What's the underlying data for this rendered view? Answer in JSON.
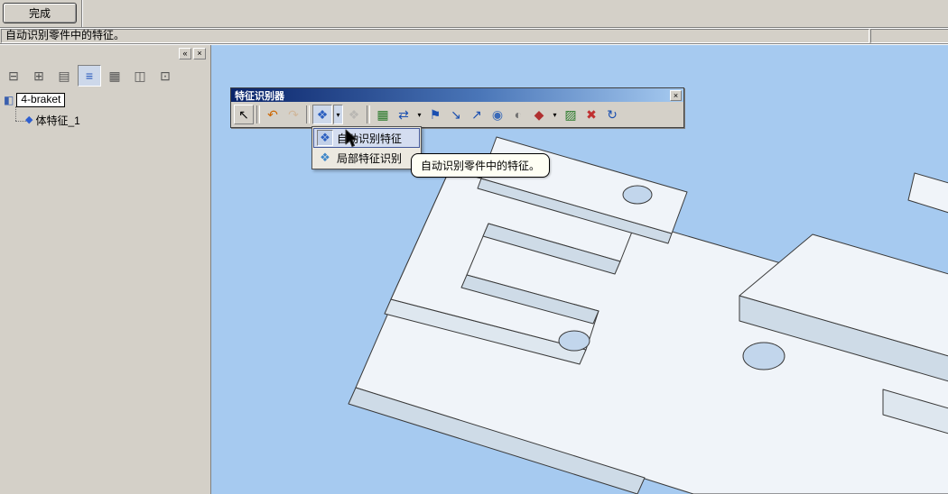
{
  "header": {
    "done_button": "完成",
    "status_left": "自动识别零件中的特征。",
    "status_right": ""
  },
  "panel": {
    "collapse_icon": "«",
    "close_icon": "×",
    "toolbar": [
      {
        "name": "feature-tree",
        "glyph": "⊟",
        "color": "#555555"
      },
      {
        "name": "display-pane",
        "glyph": "⊞",
        "color": "#555555"
      },
      {
        "name": "section-view",
        "glyph": "▤",
        "color": "#555555"
      },
      {
        "name": "layers-display",
        "glyph": "≡",
        "color": "#2255bb"
      },
      {
        "name": "grid-display",
        "glyph": "▦",
        "color": "#555555"
      },
      {
        "name": "camera-views",
        "glyph": "◫",
        "color": "#555555"
      },
      {
        "name": "hierarchy",
        "glyph": "⊡",
        "color": "#555555"
      }
    ],
    "tree": {
      "root": "4-braket",
      "root_icon": "◧",
      "root_icon_color": "#3a5fae",
      "child": "体特征_1",
      "child_icon": "◆",
      "child_icon_color": "#2f5fd0"
    }
  },
  "recognizer": {
    "title": "特征识别器",
    "close": "×",
    "caret_glyph": "▾",
    "icons": [
      {
        "name": "select-tool",
        "glyph": "↖",
        "color": "#000000"
      },
      {
        "name": "undo",
        "glyph": "↶",
        "color": "#cc6600"
      },
      {
        "name": "redo",
        "glyph": "↷",
        "color": "#cc9966"
      },
      {
        "name": "auto-recognize-features",
        "glyph": "❖",
        "color": "#2b5fc0"
      },
      {
        "name": "recognize-disabled",
        "glyph": "❖",
        "color": "#9a9a9a"
      },
      {
        "name": "feature-map",
        "glyph": "▦",
        "color": "#2a7a2a"
      },
      {
        "name": "swap-direction",
        "glyph": "⇄",
        "color": "#1a4fb0"
      },
      {
        "name": "flag-feature",
        "glyph": "⚑",
        "color": "#1a4fb0"
      },
      {
        "name": "step-forward",
        "glyph": "↘",
        "color": "#1a4fb0"
      },
      {
        "name": "step-up",
        "glyph": "↗",
        "color": "#1a4fb0"
      },
      {
        "name": "globe-view",
        "glyph": "◉",
        "color": "#3a6ab8"
      },
      {
        "name": "shaded-view",
        "glyph": "◐",
        "color": "#707070"
      },
      {
        "name": "paint-features",
        "glyph": "◆",
        "color": "#b03030"
      },
      {
        "name": "grid-options",
        "glyph": "▨",
        "color": "#2a7a2a"
      },
      {
        "name": "delete-feature",
        "glyph": "✖",
        "color": "#c03030"
      },
      {
        "name": "refresh",
        "glyph": "↻",
        "color": "#1a4fb0"
      }
    ]
  },
  "menu": {
    "items": [
      {
        "name": "auto-recognize",
        "label": "自动识别特征",
        "glyph": "❖",
        "color": "#2b5fc0"
      },
      {
        "name": "local-recognize",
        "label": "局部特征识别",
        "glyph": "❖",
        "color": "#3f87c9"
      }
    ]
  },
  "tooltip": "自动识别零件中的特征。",
  "colors": {
    "viewport": "#a6caf0",
    "chrome": "#d4d0c8",
    "model_face": "#f0f4f9",
    "model_shade": "#cedbe7",
    "model_shade2": "#dee7ef",
    "model_hole": "#c2d6ec",
    "title_grad_a": "#0a246a",
    "title_grad_b": "#4a76b8",
    "title_grad_c": "#a6caf0",
    "menu_highlight": "#d4ddf0",
    "pressed_bg": "#cdd8ea"
  }
}
